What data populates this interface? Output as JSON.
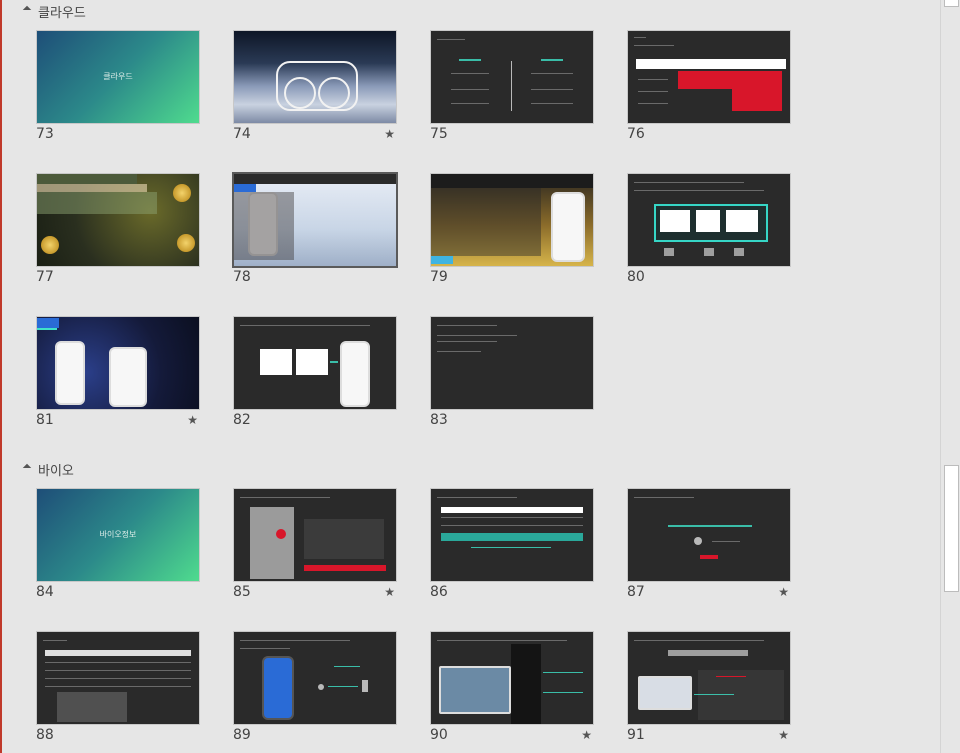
{
  "sections": [
    {
      "title": "클라우드",
      "collapsed": false
    },
    {
      "title": "바이오",
      "collapsed": false
    }
  ],
  "slides": [
    {
      "number": "73",
      "label": "클라우드",
      "starred": false
    },
    {
      "number": "74",
      "label": "",
      "starred": true
    },
    {
      "number": "75",
      "label": "",
      "starred": false
    },
    {
      "number": "76",
      "label": "",
      "starred": false
    },
    {
      "number": "77",
      "label": "",
      "starred": false
    },
    {
      "number": "78",
      "label": "",
      "starred": false,
      "selected": true
    },
    {
      "number": "79",
      "label": "",
      "starred": false
    },
    {
      "number": "80",
      "label": "",
      "starred": false
    },
    {
      "number": "81",
      "label": "",
      "starred": true
    },
    {
      "number": "82",
      "label": "",
      "starred": false
    },
    {
      "number": "83",
      "label": "",
      "starred": false
    },
    {
      "number": "84",
      "label": "바이오정보",
      "starred": false
    },
    {
      "number": "85",
      "label": "",
      "starred": true
    },
    {
      "number": "86",
      "label": "",
      "starred": false
    },
    {
      "number": "87",
      "label": "",
      "starred": true
    },
    {
      "number": "88",
      "label": "",
      "starred": false
    },
    {
      "number": "89",
      "label": "",
      "starred": false
    },
    {
      "number": "90",
      "label": "",
      "starred": true
    },
    {
      "number": "91",
      "label": "",
      "starred": true
    }
  ],
  "star_symbol": "★",
  "colors": {
    "accent_teal": "#3fe2c8",
    "accent_red": "#d8162a"
  }
}
